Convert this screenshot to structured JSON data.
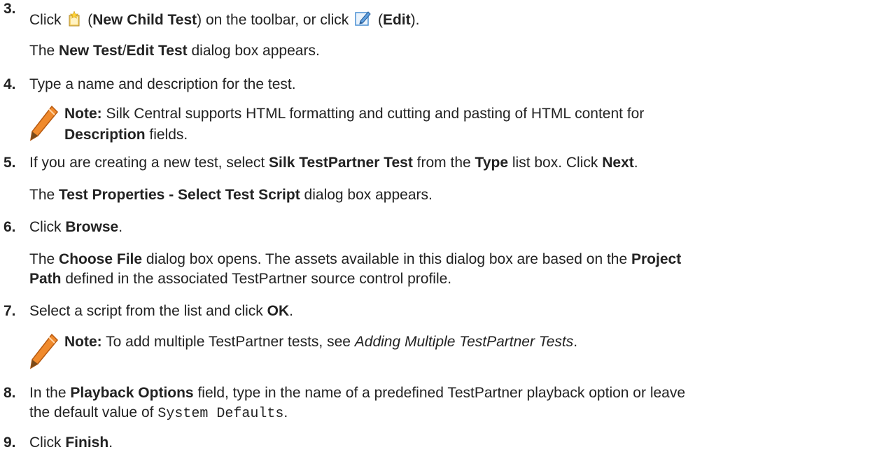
{
  "steps": [
    {
      "num": "3.",
      "text": {
        "a": "Click",
        "b": "(",
        "new_child_test": "New Child Test",
        "c": ") on the toolbar, or click",
        "d": "(",
        "edit": "Edit",
        "e": ")."
      },
      "sub": {
        "a": "The",
        "new_test": "New Test",
        "slash": "/",
        "edit_test": "Edit Test",
        "b": "dialog box appears."
      },
      "icons": [
        "new-child-test-icon",
        "edit-icon"
      ]
    },
    {
      "num": "4.",
      "text": "Type a name and description for the test.",
      "note": {
        "label": "Note:",
        "line1": "Silk Central supports HTML formatting and cutting and pasting of HTML content for",
        "description": "Description",
        "line2": "fields."
      }
    },
    {
      "num": "5.",
      "text": {
        "a": "If you are creating a new test, select",
        "silk_test": "Silk TestPartner Test",
        "b": "from the",
        "type": "Type",
        "c": "list box. Click",
        "next": "Next",
        "d": "."
      },
      "sub": {
        "a": "The",
        "dialog": "Test Properties - Select Test Script",
        "b": "dialog box appears."
      }
    },
    {
      "num": "6.",
      "text": {
        "a": "Click",
        "browse": "Browse",
        "b": "."
      },
      "sub": {
        "a": "The",
        "choose_file": "Choose File",
        "b": "dialog box opens. The assets available in this dialog box are based on the",
        "project": "Project",
        "path": "Path",
        "c": "defined in the associated TestPartner source control profile."
      }
    },
    {
      "num": "7.",
      "text": {
        "a": "Select a script from the list and click",
        "ok": "OK",
        "b": "."
      },
      "note": {
        "label": "Note:",
        "a": "To add multiple TestPartner tests, see",
        "link": "Adding Multiple TestPartner Tests",
        "b": "."
      }
    },
    {
      "num": "8.",
      "text": {
        "a": "In the",
        "playback": "Playback Options",
        "b": "field, type in the name of a predefined TestPartner playback option or leave",
        "c": "the default value of",
        "code": "System Defaults",
        "d": "."
      }
    },
    {
      "num": "9.",
      "text": {
        "a": "Click",
        "finish": "Finish",
        "b": "."
      }
    }
  ],
  "colors": {
    "text": "#222222",
    "pencil": "#e87722",
    "pencil_tip": "#7a4a1a",
    "edit_icon": "#4a8fd4",
    "new_icon": "#f2c94c"
  }
}
